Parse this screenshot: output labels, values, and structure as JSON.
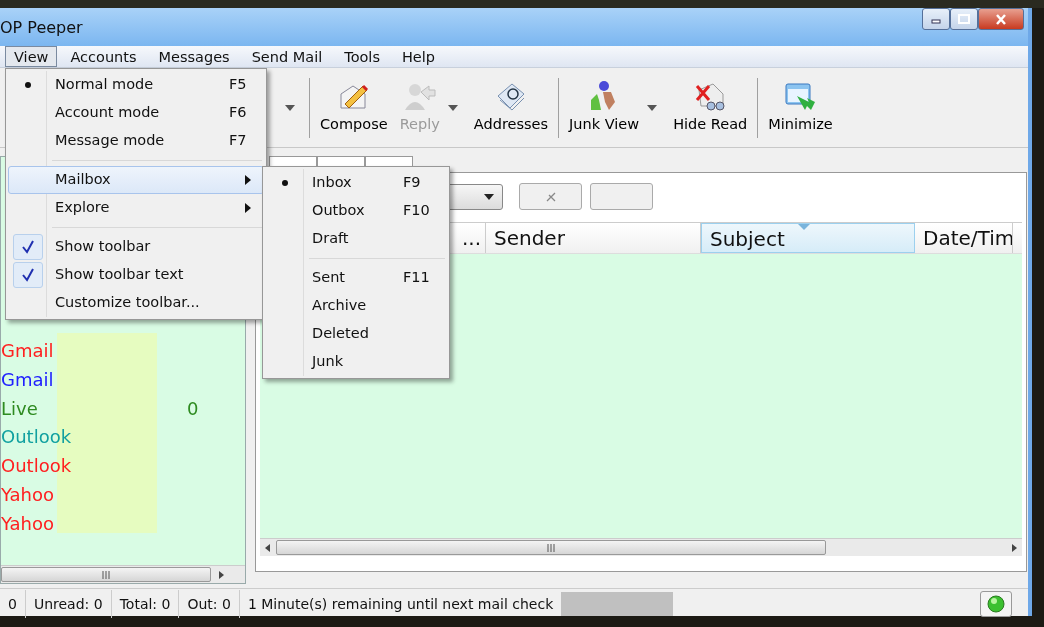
{
  "window": {
    "title": "OP Peeper"
  },
  "menu_bar": [
    {
      "label": "View",
      "selected": true
    },
    {
      "label": "Accounts",
      "selected": false
    },
    {
      "label": "Messages",
      "selected": false
    },
    {
      "label": "Send Mail",
      "selected": false
    },
    {
      "label": "Tools",
      "selected": false
    },
    {
      "label": "Help",
      "selected": false
    }
  ],
  "view_menu": [
    {
      "kind": "radio",
      "label": "Normal mode",
      "shortcut": "F5",
      "checked": true
    },
    {
      "kind": "radio",
      "label": "Account mode",
      "shortcut": "F6",
      "checked": false
    },
    {
      "kind": "radio",
      "label": "Message mode",
      "shortcut": "F7",
      "checked": false
    },
    {
      "kind": "separator"
    },
    {
      "kind": "submenu",
      "label": "Mailbox",
      "selected": true
    },
    {
      "kind": "submenu",
      "label": "Explore",
      "selected": false
    },
    {
      "kind": "separator"
    },
    {
      "kind": "check",
      "label": "Show toolbar",
      "checked": true
    },
    {
      "kind": "check",
      "label": "Show toolbar text",
      "checked": true
    },
    {
      "kind": "command",
      "label": "Customize toolbar..."
    }
  ],
  "mailbox_submenu": [
    {
      "kind": "radio",
      "label": "Inbox",
      "shortcut": "F9",
      "checked": true
    },
    {
      "kind": "radio",
      "label": "Outbox",
      "shortcut": "F10",
      "checked": false
    },
    {
      "kind": "radio",
      "label": "Draft",
      "checked": false
    },
    {
      "kind": "separator"
    },
    {
      "kind": "radio",
      "label": "Sent",
      "shortcut": "F11",
      "checked": false
    },
    {
      "kind": "radio",
      "label": "Archive",
      "checked": false
    },
    {
      "kind": "radio",
      "label": "Deleted",
      "checked": false
    },
    {
      "kind": "radio",
      "label": "Junk",
      "checked": false
    }
  ],
  "toolbar": [
    {
      "kind": "dropdown"
    },
    {
      "kind": "separator"
    },
    {
      "kind": "button",
      "label": "Compose",
      "disabled": false
    },
    {
      "kind": "button",
      "label": "Reply",
      "disabled": true
    },
    {
      "kind": "dropdown"
    },
    {
      "kind": "button",
      "label": "Addresses",
      "disabled": false
    },
    {
      "kind": "separator"
    },
    {
      "kind": "button",
      "label": "Junk View",
      "disabled": false
    },
    {
      "kind": "dropdown"
    },
    {
      "kind": "button",
      "label": "Hide Read",
      "disabled": false
    },
    {
      "kind": "separator"
    },
    {
      "kind": "button",
      "label": "Minimize",
      "disabled": false
    }
  ],
  "accounts": [
    {
      "name": "Gmail",
      "color": "#ff2020"
    },
    {
      "name": "Gmail",
      "color": "#2020ff"
    },
    {
      "name": "Live",
      "color": "#2e8b20",
      "count": "0"
    },
    {
      "name": "Outlook",
      "color": "#10a0a0"
    },
    {
      "name": "Outlook",
      "color": "#ff2020"
    },
    {
      "name": "Yahoo",
      "color": "#ff2020"
    },
    {
      "name": "Yahoo",
      "color": "#ff2020"
    }
  ],
  "message_list": {
    "columns": [
      {
        "label": "...",
        "sorted": false
      },
      {
        "label": "Sender",
        "sorted": false
      },
      {
        "label": "Subject",
        "sorted": true
      },
      {
        "label": "Date/Tim",
        "sorted": false
      }
    ]
  },
  "status_bar": {
    "cells": [
      "0",
      "Unread: 0",
      "Total: 0",
      "Out: 0",
      "1 Minute(s) remaining until next mail check"
    ],
    "connected": true
  }
}
